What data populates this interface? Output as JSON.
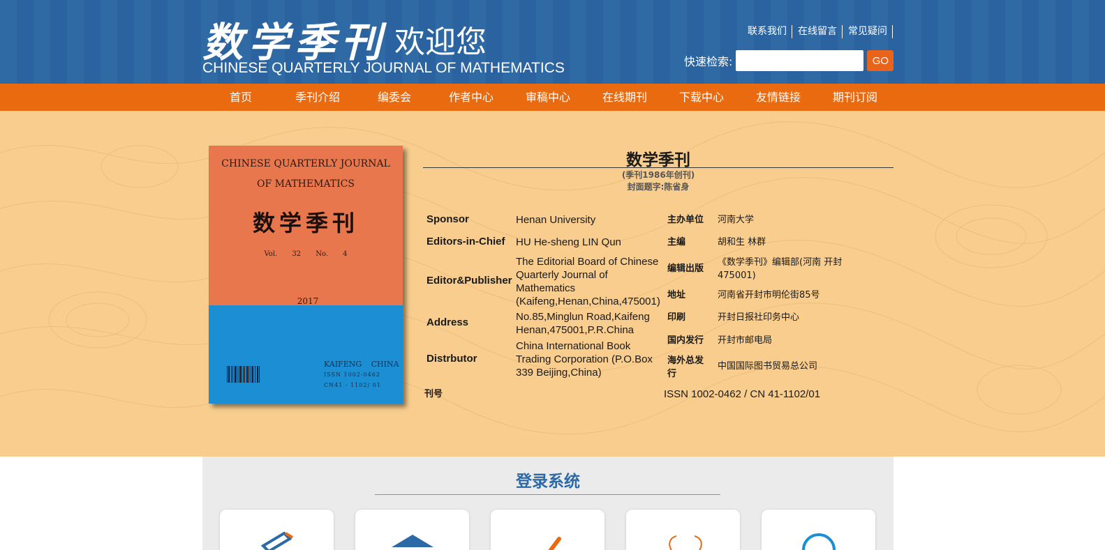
{
  "header": {
    "logo_cn": "数学季刊",
    "logo_welcome": "欢迎您",
    "logo_en": "CHINESE QUARTERLY JOURNAL OF MATHEMATICS",
    "top_links": [
      "联系我们",
      "在线留言",
      "常见疑问"
    ],
    "search": {
      "label": "快速检索:",
      "value": "",
      "button": "GO"
    }
  },
  "nav": {
    "items": [
      "首页",
      "季刊介绍",
      "编委会",
      "作者中心",
      "审稿中心",
      "在线期刊",
      "下载中心",
      "友情链接",
      "期刊订阅"
    ]
  },
  "cover": {
    "en_line1": "CHINESE QUARTERLY JOURNAL",
    "en_line2": "OF MATHEMATICS",
    "cn_title": "数学季刊",
    "vol": "Vol. 32     No. 4",
    "year": "2017",
    "publisher_line1": "KAIFENG  CHINA",
    "publisher_line2": "ISSN  1002-0462",
    "publisher_line3": "CN41 - 1102/ 01"
  },
  "journal": {
    "title": "数学季刊",
    "founded": "(季刊1986年创刊)",
    "inscription": "封面题字:陈省身"
  },
  "info_en": [
    {
      "label": "Sponsor",
      "value": "Henan University"
    },
    {
      "label": "Editors-in-Chief",
      "value": "HU He-sheng  LIN Qun"
    },
    {
      "label": "Editor&Publisher",
      "value": "The Editorial Board of Chinese Quarterly Journal of Mathematics (Kaifeng,Henan,China,475001)"
    },
    {
      "label": "Address",
      "value": "No.85,Minglun Road,Kaifeng Henan,475001,P.R.China"
    },
    {
      "label": "Distrbutor",
      "value": "China International Book Trading Corporation (P.O.Box 339 Beijing,China)"
    }
  ],
  "info_cn": [
    {
      "label": "主办单位",
      "value": "河南大学"
    },
    {
      "label": "主编",
      "value": "胡和生  林群"
    },
    {
      "label": "编辑出版",
      "value": "《数学季刊》编辑部(河南 开封 475001)"
    },
    {
      "label": "地址",
      "value": "河南省开封市明伦街85号"
    },
    {
      "label": "印刷",
      "value": "开封日报社印务中心"
    },
    {
      "label": "国内发行",
      "value": "开封市邮电局"
    },
    {
      "label": "海外总发行",
      "value": "中国国际图书贸易总公司"
    }
  ],
  "issn": {
    "label": "刊号",
    "value": "ISSN  1002-0462  /  CN  41-1102/01"
  },
  "login": {
    "title": "登录系统",
    "cards": [
      "author-login",
      "editor-login",
      "reviewer-login",
      "chief-editor-login",
      "search-login"
    ]
  },
  "colors": {
    "header_blue": "#2f6aa5",
    "nav_orange": "#ea6a10",
    "intro_bg": "#f8cd8e",
    "login_title": "#2b69a7"
  }
}
